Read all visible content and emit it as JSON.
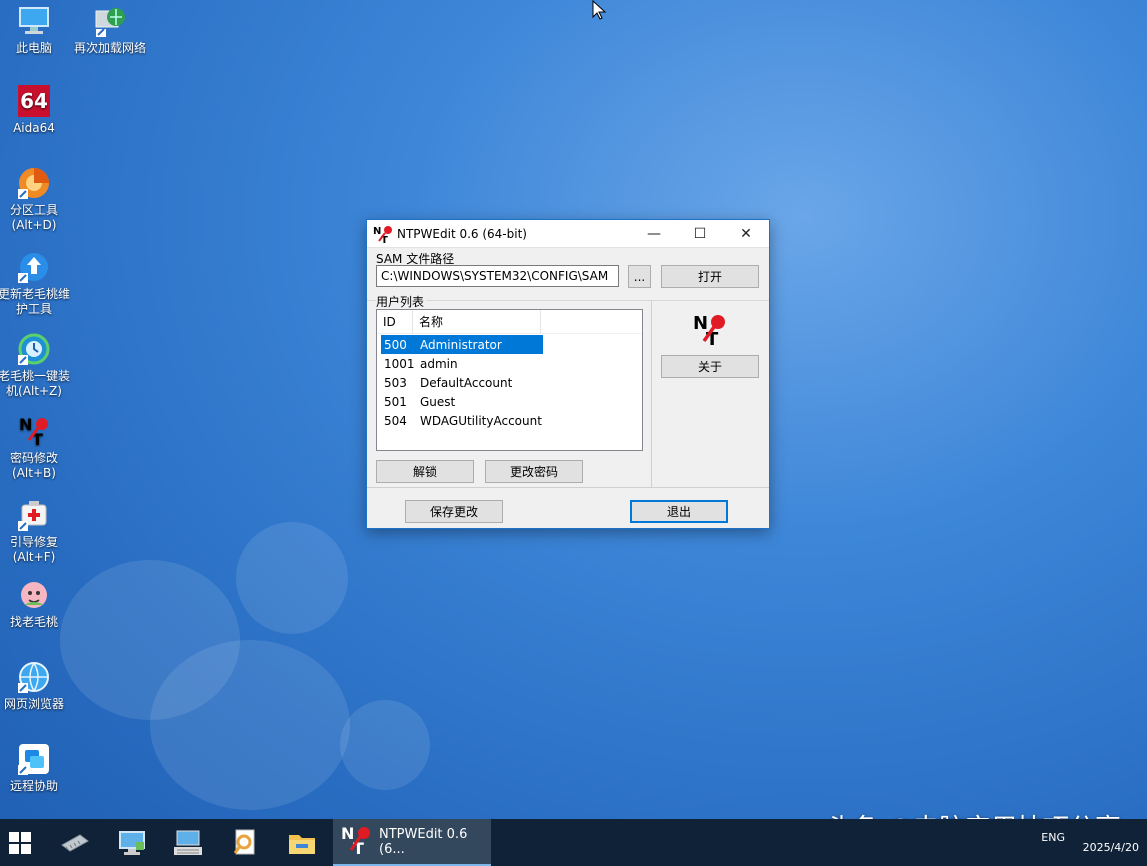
{
  "desktop": {
    "icons": [
      {
        "label": "此电脑",
        "icon": "computer-icon"
      },
      {
        "label": "再次加载网络",
        "icon": "network-icon"
      },
      {
        "label": "Aida64",
        "icon": "aida64-icon"
      },
      {
        "label": "分区工具\n(Alt+D)",
        "icon": "partition-tool-icon"
      },
      {
        "label": "更新老毛桃维\n护工具",
        "icon": "update-tool-icon"
      },
      {
        "label": "老毛桃一键装\n机(Alt+Z)",
        "icon": "one-click-install-icon"
      },
      {
        "label": "密码修改\n(Alt+B)",
        "icon": "password-edit-icon"
      },
      {
        "label": "引导修复\n(Alt+F)",
        "icon": "boot-repair-icon"
      },
      {
        "label": "找老毛桃",
        "icon": "find-laomaotao-icon"
      },
      {
        "label": "网页浏览器",
        "icon": "web-browser-icon"
      },
      {
        "label": "远程协助",
        "icon": "remote-assist-icon"
      }
    ],
    "aida_badge": "64"
  },
  "window": {
    "title": "NTPWEdit 0.6 (64-bit)",
    "controls": {
      "minimize": "—",
      "maximize": "☐",
      "close": "✕"
    },
    "sam_label": "SAM 文件路径",
    "sam_path": "C:\\WINDOWS\\SYSTEM32\\CONFIG\\SAM",
    "browse_label": "...",
    "open_label": "打开",
    "user_list_label": "用户列表",
    "columns": {
      "id": "ID",
      "name": "名称"
    },
    "users": [
      {
        "id": "500",
        "name": "Administrator"
      },
      {
        "id": "1001",
        "name": "admin"
      },
      {
        "id": "503",
        "name": "DefaultAccount"
      },
      {
        "id": "501",
        "name": "Guest"
      },
      {
        "id": "504",
        "name": "WDAGUtilityAccount"
      }
    ],
    "selected_user": "500",
    "about_label": "关于",
    "unlock_label": "解锁",
    "change_password_label": "更改密码",
    "save_label": "保存更改",
    "exit_label": "退出"
  },
  "taskbar": {
    "active_app_label": "NTPWEdit 0.6 (6...",
    "lang": "ENG",
    "date": "2025/4/20"
  },
  "watermark": "头条 @电脑实用技巧分享",
  "colors": {
    "accent": "#0078d7",
    "taskbar": "#0f2238",
    "desktop": "#2a6fc4"
  }
}
